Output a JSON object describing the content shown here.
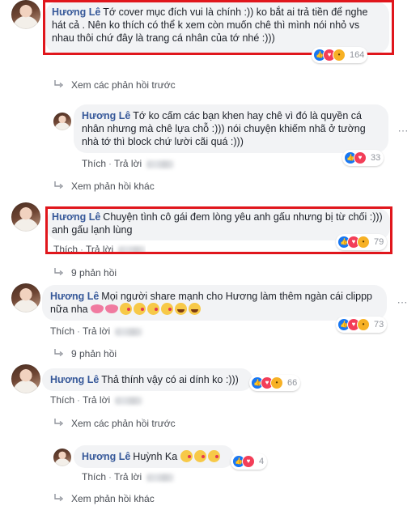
{
  "author": "Hương Lê",
  "like_label": "Thích",
  "reply_label": "Trả lời",
  "prev_replies_label": "Xem các phản hồi trước",
  "other_replies_label": "Xem phản hồi khác",
  "nine_replies_label": "9 phản hồi",
  "accent_colors": {
    "link": "#365899",
    "highlight_border": "#e0161c",
    "bubble": "#f2f3f5"
  },
  "comments": [
    {
      "text": "Tớ cover mục đích vui là chính :)) ko bắt ai trả tiền để nghe hát cả . Nên ko thích có thể k xem còn muốn chê thì mình nói nhỏ vs nhau thôi chứ đây là trang cá nhân của tớ nhé :)))",
      "reactions": "164"
    },
    {
      "text": "Tớ ko cấm các bạn khen hay chê vì đó là quyền cá nhân nhưng mà chê lựa chỗ :))) nói chuyện khiếm nhã ở tường nhà tớ thì block chứ lười cãi quá :)))",
      "reactions": "33"
    },
    {
      "text": "Chuyện tình cô gái đem lòng yêu anh gấu nhưng bị từ chối :))) anh gấu lạnh lùng",
      "reactions": "79"
    },
    {
      "text": "Mọi người share mạnh cho Hương làm thêm ngàn cái clippp nữa nha",
      "reactions": "73"
    },
    {
      "text": "Thả thính vậy có ai dính ko :)))",
      "reactions": "66"
    },
    {
      "text": "Huỳnh Ka",
      "reactions": "4"
    }
  ]
}
